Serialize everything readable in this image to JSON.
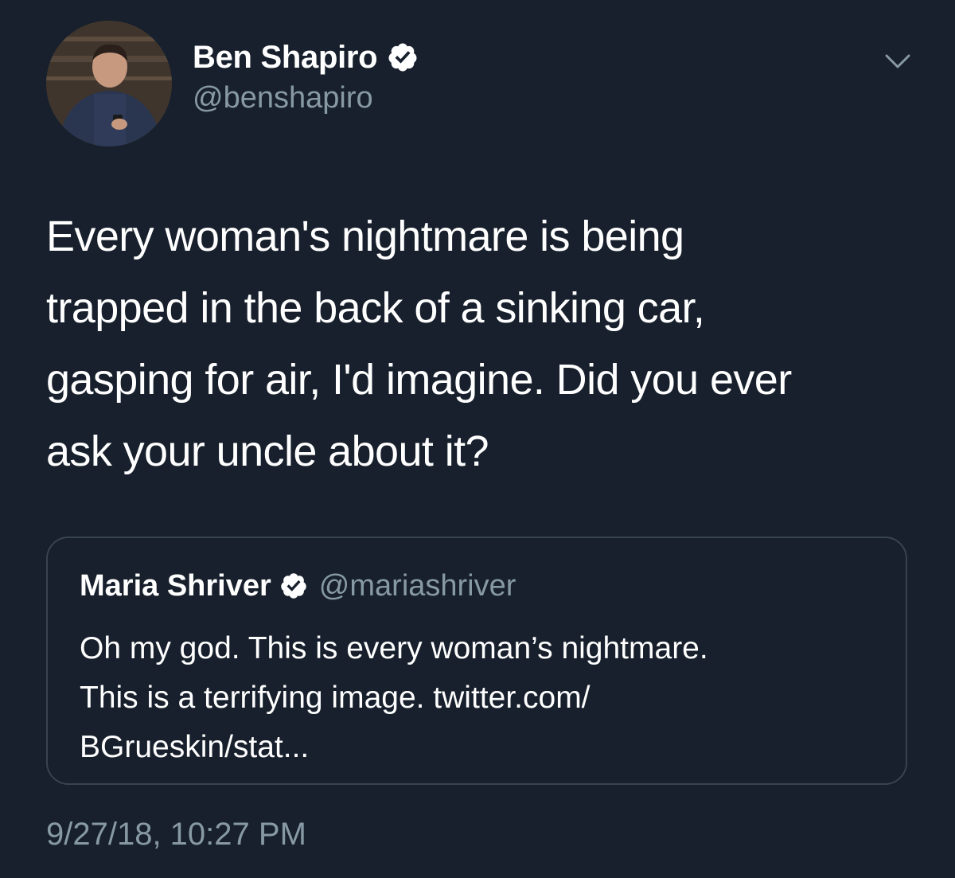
{
  "tweet": {
    "author": {
      "display_name": "Ben Shapiro",
      "handle": "@benshapiro",
      "verified": true,
      "avatar_icon": "profile-photo"
    },
    "text_lines": [
      "Every woman's nightmare is being",
      "trapped in the back of a sinking car,",
      "gasping for air, I'd imagine. Did you ever",
      "ask your uncle about it?"
    ],
    "menu_icon": "chevron-down-icon",
    "timestamp": "9/27/18, 10:27 PM"
  },
  "quoted_tweet": {
    "display_name": "Maria Shriver",
    "handle": "@mariashriver",
    "verified": true,
    "text_lines": [
      "Oh my god. This is every woman’s nightmare.",
      "This is a terrifying image. twitter.com/",
      "BGrueskin/stat..."
    ]
  },
  "colors": {
    "background": "#17202c",
    "primary_text": "#ffffff",
    "secondary_text": "#8899a6",
    "border": "#38444d",
    "verified_badge": "#ffffff"
  }
}
